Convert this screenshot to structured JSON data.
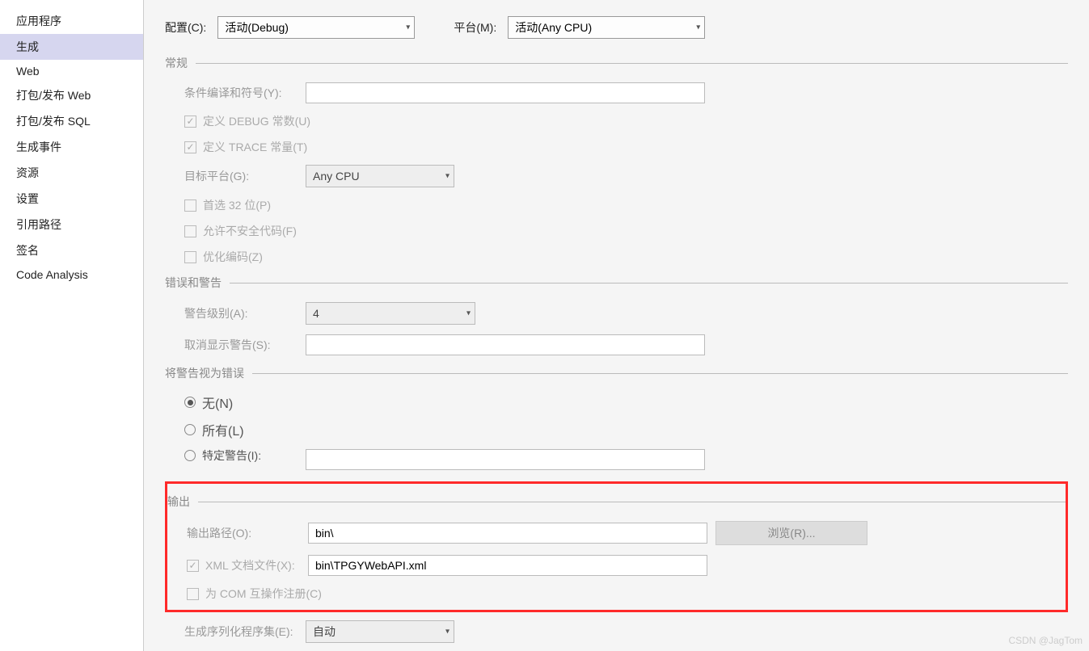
{
  "sidebar": {
    "items": [
      {
        "label": "应用程序"
      },
      {
        "label": "生成",
        "active": true
      },
      {
        "label": "Web"
      },
      {
        "label": "打包/发布 Web"
      },
      {
        "label": "打包/发布 SQL"
      },
      {
        "label": "生成事件"
      },
      {
        "label": "资源"
      },
      {
        "label": "设置"
      },
      {
        "label": "引用路径"
      },
      {
        "label": "签名"
      },
      {
        "label": "Code Analysis"
      }
    ]
  },
  "top": {
    "config_label": "配置(C):",
    "config_value": "活动(Debug)",
    "platform_label": "平台(M):",
    "platform_value": "活动(Any CPU)"
  },
  "sections": {
    "general": "常规",
    "errors": "错误和警告",
    "warn_as_err": "将警告视为错误",
    "output": "输出"
  },
  "general": {
    "cond_symbols": "条件编译和符号(Y):",
    "def_debug": "定义 DEBUG 常数(U)",
    "def_trace": "定义 TRACE 常量(T)",
    "target_platform": "目标平台(G):",
    "target_platform_value": "Any CPU",
    "prefer32": "首选 32 位(P)",
    "allow_unsafe": "允许不安全代码(F)",
    "optimize": "优化编码(Z)"
  },
  "errors_cfg": {
    "warn_level_label": "警告级别(A):",
    "warn_level_value": "4",
    "suppress_label": "取消显示警告(S):"
  },
  "warn_err": {
    "none": "无(N)",
    "all": "所有(L)",
    "specific": "特定警告(I):"
  },
  "output": {
    "out_path_label": "输出路径(O):",
    "out_path_value": "bin\\",
    "browse": "浏览(R)...",
    "xml_doc_label": "XML 文档文件(X):",
    "xml_doc_value": "bin\\TPGYWebAPI.xml",
    "com_reg": "为 COM 互操作注册(C)",
    "serialize_label": "生成序列化程序集(E):",
    "serialize_value": "自动"
  },
  "watermark": "CSDN @JagTom"
}
